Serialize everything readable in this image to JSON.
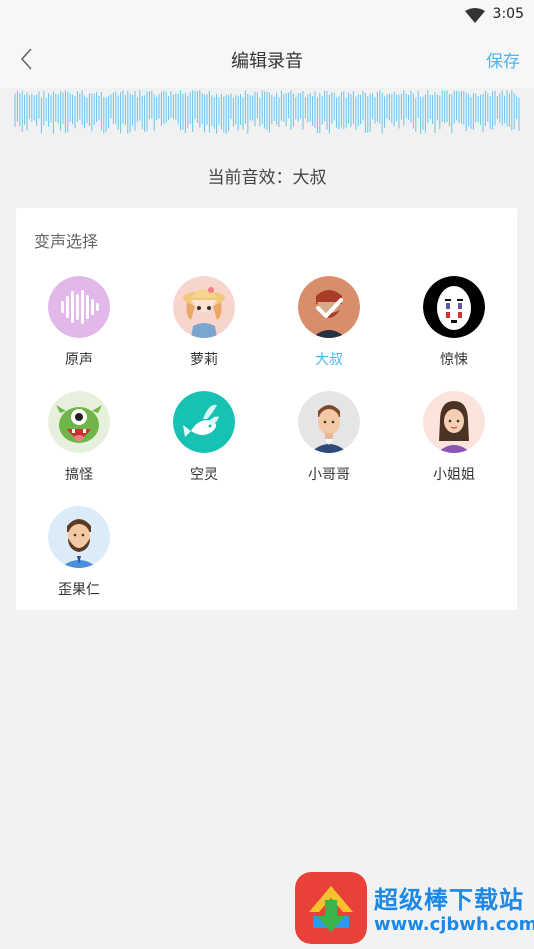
{
  "status": {
    "time": "3:05",
    "wifi_icon": "wifi-icon"
  },
  "nav": {
    "title": "编辑录音",
    "save_label": "保存",
    "back_icon": "back-chevron-icon"
  },
  "current_effect": {
    "label": "当前音效：",
    "value": "大叔"
  },
  "panel": {
    "title": "变声选择",
    "voices": [
      {
        "label": "原声",
        "icon": "waveform-icon",
        "selected": false
      },
      {
        "label": "萝莉",
        "icon": "girl-avatar-icon",
        "selected": false
      },
      {
        "label": "大叔",
        "icon": "uncle-avatar-icon",
        "selected": true
      },
      {
        "label": "惊悚",
        "icon": "noface-mask-icon",
        "selected": false
      },
      {
        "label": "搞怪",
        "icon": "monster-avatar-icon",
        "selected": false
      },
      {
        "label": "空灵",
        "icon": "fish-icon",
        "selected": false
      },
      {
        "label": "小哥哥",
        "icon": "young-man-avatar-icon",
        "selected": false
      },
      {
        "label": "小姐姐",
        "icon": "young-woman-avatar-icon",
        "selected": false
      },
      {
        "label": "歪果仁",
        "icon": "foreigner-avatar-icon",
        "selected": false
      }
    ]
  },
  "watermark": {
    "brand": "超级棒下载站",
    "url": "www.cjbwh.com"
  },
  "colors": {
    "accent": "#4ab6f0",
    "wave": "#6cc4e8",
    "background": "#f2f2f2"
  }
}
